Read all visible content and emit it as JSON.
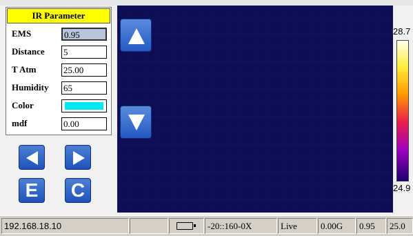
{
  "panel": {
    "title": "IR Parameter",
    "rows": [
      {
        "label": "EMS",
        "value": "0.95"
      },
      {
        "label": "Distance",
        "value": "5"
      },
      {
        "label": "T Atm",
        "value": "25.00"
      },
      {
        "label": "Humidity",
        "value": "65"
      },
      {
        "label": "Color",
        "value": ""
      },
      {
        "label": "mdf",
        "value": "0.00"
      }
    ],
    "color_value": "#00e8f0"
  },
  "buttons": {
    "left_icon": "arrow-left-icon",
    "right_icon": "arrow-right-icon",
    "e_label": "E",
    "c_label": "C",
    "up_icon": "arrow-up-icon",
    "down_icon": "arrow-down-icon"
  },
  "scale": {
    "max": "28.7",
    "min": "24.9"
  },
  "status": {
    "ip": "192.168.18.10",
    "empty": "",
    "battery_icon": "battery-icon",
    "range": "-20::160-0X",
    "mode": "Live",
    "gain": "0.00G",
    "ems": "0.95",
    "temp": "25.0"
  },
  "colors": {
    "thermal_bg": "#0e0d56",
    "panel_title_bg": "#ffff00",
    "button_blue": "#1e52b8"
  }
}
